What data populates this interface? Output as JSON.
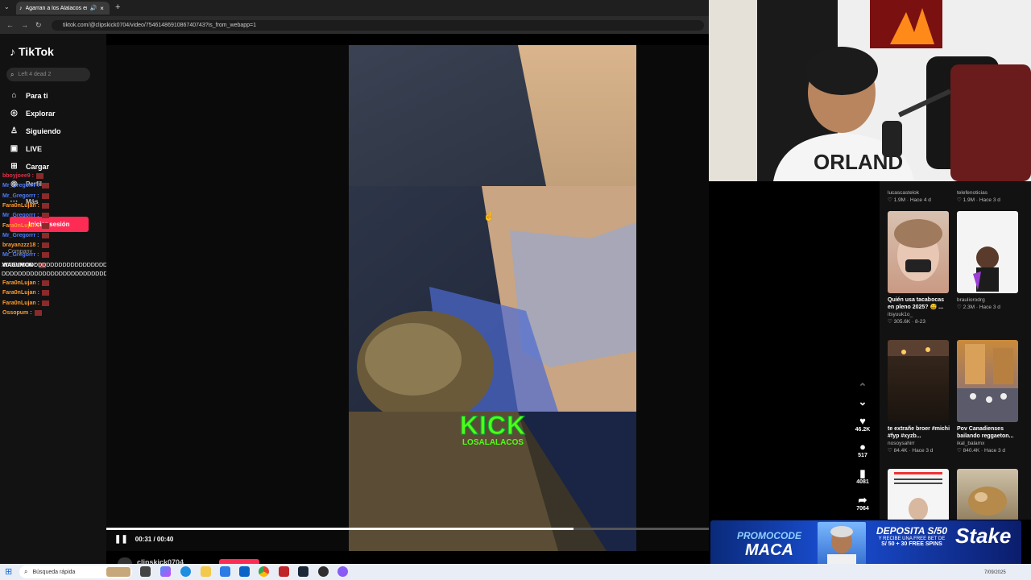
{
  "browser": {
    "tab_title": "Agarran a los Alalacos en el",
    "url": "tiktok.com/@clipskick0704/video/7546148691086740743?is_from_webapp=1"
  },
  "sidebar": {
    "brand": "TikTok",
    "search_placeholder": "Left 4 dead 2",
    "items": [
      {
        "label": "Para ti",
        "icon": "home-icon"
      },
      {
        "label": "Explorar",
        "icon": "compass-icon"
      },
      {
        "label": "Siguiendo",
        "icon": "following-icon"
      },
      {
        "label": "LIVE",
        "icon": "live-icon"
      },
      {
        "label": "Cargar",
        "icon": "upload-icon"
      },
      {
        "label": "Perfil",
        "icon": "profile-icon"
      },
      {
        "label": "Más",
        "icon": "more-icon"
      }
    ],
    "login_label": "Iniciar sesión",
    "footer_label": "Company"
  },
  "chat": {
    "messages": [
      {
        "user": "bboyjoee9 :",
        "color": "#e0304a"
      },
      {
        "user": "Mr_Gregorrr :",
        "color": "#4f7cff"
      },
      {
        "user": "Mr_Gregorrr :",
        "color": "#4f7cff"
      },
      {
        "user": "Fara0nLujan :",
        "color": "#ff9a2e"
      },
      {
        "user": "Mr_Gregorrr :",
        "color": "#4f7cff"
      },
      {
        "user": "Fara0nLujan :",
        "color": "#ff9a2e"
      },
      {
        "user": "Mr_Gregorrr :",
        "color": "#4f7cff"
      },
      {
        "user": "brayanzzz18 :",
        "color": "#ff9a2e"
      },
      {
        "user": "Mr_Gregorrr :",
        "color": "#4f7cff"
      },
      {
        "user": "WAGUMON :",
        "color": "#ffffff"
      }
    ],
    "spam_line_1": "XDDDDDDDDDDDDDDDDDDDDDDDDDDDDDDDDDDDDDDDDDDDDDDDDDD",
    "spam_line_2": "DDDDDDDDDDDDDDDDDDDDDDDDDDDDDDDDDDDDDDDDDDDDDDDDDDDD",
    "messages_2": [
      {
        "user": "Fara0nLujan :",
        "color": "#ff9a2e"
      },
      {
        "user": "Fara0nLujan :",
        "color": "#ff9a2e"
      },
      {
        "user": "Fara0nLujan :",
        "color": "#ff9a2e"
      },
      {
        "user": "Ossopum :",
        "color": "#ff9a2e"
      }
    ]
  },
  "video": {
    "watermark_big": "KICK",
    "watermark_small": "LOSALALACOS",
    "time": "00:31 / 00:40",
    "progress": 0.775,
    "author": "clipskick0704"
  },
  "actions": {
    "likes": "46.2K",
    "comments": "517",
    "saves": "4081",
    "shares": "7064"
  },
  "recommendations": {
    "row0": [
      {
        "title": "",
        "author": "lucascastelok",
        "stats": "♡ 1.9M · Hace 4 d"
      },
      {
        "title": "",
        "author": "telefenoticias",
        "stats": "♡ 1.9M · Hace 3 d"
      }
    ],
    "row1": [
      {
        "title": "Quién usa tacabocas en pleno 2025? 😅 ...",
        "author": "itsyuuk1o_",
        "stats": "♡ 305.6K · 8-23"
      },
      {
        "title": "",
        "author": "brauliorodrg",
        "stats": "♡ 2.3M · Hace 3 d"
      }
    ],
    "row2": [
      {
        "title": "te extrañe broer #michi #fyp #xyzb...",
        "author": "nosoysahirr",
        "stats": "♡ 84.4K · Hace 3 d"
      },
      {
        "title": "Pov Canadienses bailando reggaeton...",
        "author": "ikal_balamx",
        "stats": "♡ 840.4K · Hace 3 d"
      }
    ]
  },
  "ad": {
    "promo_label": "PROMOCODE",
    "promo_code": "MACA",
    "deposit": "DEPOSITA S/50",
    "deposit_sub": "Y RECIBE UNA FREE BET DE",
    "bonus": "S/ 50 + 30 FREE SPINS",
    "brand": "Stake"
  },
  "taskbar": {
    "search_label": "Búsqueda rápida",
    "date": "7/09/2025"
  }
}
